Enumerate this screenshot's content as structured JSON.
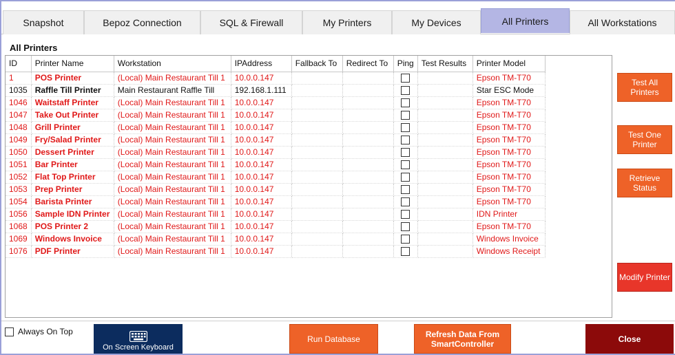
{
  "tabs": [
    {
      "label": "Snapshot"
    },
    {
      "label": "Bepoz Connection"
    },
    {
      "label": "SQL & Firewall"
    },
    {
      "label": "My Printers"
    },
    {
      "label": "My Devices"
    },
    {
      "label": "All Printers",
      "active": true
    },
    {
      "label": "All Workstations"
    }
  ],
  "panel_title": "All Printers",
  "columns": [
    "ID",
    "Printer Name",
    "Workstation",
    "IPAddress",
    "Fallback To",
    "Redirect To",
    "Ping",
    "Test Results",
    "Printer Model"
  ],
  "rows": [
    {
      "id": "1",
      "name": "POS Printer",
      "workstation": "(Local) Main Restaurant Till 1",
      "ip": "10.0.0.147",
      "fallback": "",
      "redirect": "",
      "ping": false,
      "test_results": "",
      "model": "Epson TM-T70",
      "status": "error"
    },
    {
      "id": "1035",
      "name": "Raffle Till Printer",
      "workstation": "Main Restaurant Raffle Till",
      "ip": "192.168.1.111",
      "fallback": "",
      "redirect": "",
      "ping": false,
      "test_results": "",
      "model": "Star ESC Mode",
      "status": "ok"
    },
    {
      "id": "1046",
      "name": "Waitstaff Printer",
      "workstation": "(Local) Main Restaurant Till 1",
      "ip": "10.0.0.147",
      "fallback": "",
      "redirect": "",
      "ping": false,
      "test_results": "",
      "model": "Epson TM-T70",
      "status": "error"
    },
    {
      "id": "1047",
      "name": "Take Out Printer",
      "workstation": "(Local) Main Restaurant Till 1",
      "ip": "10.0.0.147",
      "fallback": "",
      "redirect": "",
      "ping": false,
      "test_results": "",
      "model": "Epson TM-T70",
      "status": "error"
    },
    {
      "id": "1048",
      "name": "Grill Printer",
      "workstation": "(Local) Main Restaurant Till 1",
      "ip": "10.0.0.147",
      "fallback": "",
      "redirect": "",
      "ping": false,
      "test_results": "",
      "model": "Epson TM-T70",
      "status": "error"
    },
    {
      "id": "1049",
      "name": "Fry/Salad Printer",
      "workstation": "(Local) Main Restaurant Till 1",
      "ip": "10.0.0.147",
      "fallback": "",
      "redirect": "",
      "ping": false,
      "test_results": "",
      "model": "Epson TM-T70",
      "status": "error"
    },
    {
      "id": "1050",
      "name": "Dessert Printer",
      "workstation": "(Local) Main Restaurant Till 1",
      "ip": "10.0.0.147",
      "fallback": "",
      "redirect": "",
      "ping": false,
      "test_results": "",
      "model": "Epson TM-T70",
      "status": "error"
    },
    {
      "id": "1051",
      "name": "Bar Printer",
      "workstation": "(Local) Main Restaurant Till 1",
      "ip": "10.0.0.147",
      "fallback": "",
      "redirect": "",
      "ping": false,
      "test_results": "",
      "model": "Epson TM-T70",
      "status": "error"
    },
    {
      "id": "1052",
      "name": "Flat Top Printer",
      "workstation": "(Local) Main Restaurant Till 1",
      "ip": "10.0.0.147",
      "fallback": "",
      "redirect": "",
      "ping": false,
      "test_results": "",
      "model": "Epson TM-T70",
      "status": "error"
    },
    {
      "id": "1053",
      "name": "Prep Printer",
      "workstation": "(Local) Main Restaurant Till 1",
      "ip": "10.0.0.147",
      "fallback": "",
      "redirect": "",
      "ping": false,
      "test_results": "",
      "model": "Epson TM-T70",
      "status": "error"
    },
    {
      "id": "1054",
      "name": "Barista Printer",
      "workstation": "(Local) Main Restaurant Till 1",
      "ip": "10.0.0.147",
      "fallback": "",
      "redirect": "",
      "ping": false,
      "test_results": "",
      "model": "Epson TM-T70",
      "status": "error"
    },
    {
      "id": "1056",
      "name": "Sample IDN Printer",
      "workstation": "(Local) Main Restaurant Till 1",
      "ip": "10.0.0.147",
      "fallback": "",
      "redirect": "",
      "ping": false,
      "test_results": "",
      "model": "IDN Printer",
      "status": "error"
    },
    {
      "id": "1068",
      "name": "POS Printer 2",
      "workstation": "(Local) Main Restaurant Till 1",
      "ip": "10.0.0.147",
      "fallback": "",
      "redirect": "",
      "ping": false,
      "test_results": "",
      "model": "Epson TM-T70",
      "status": "error"
    },
    {
      "id": "1069",
      "name": "Windows Invoice",
      "workstation": "(Local) Main Restaurant Till 1",
      "ip": "10.0.0.147",
      "fallback": "",
      "redirect": "",
      "ping": false,
      "test_results": "",
      "model": "Windows Invoice",
      "status": "error"
    },
    {
      "id": "1076",
      "name": "PDF Printer",
      "workstation": "(Local) Main Restaurant Till 1",
      "ip": "10.0.0.147",
      "fallback": "",
      "redirect": "",
      "ping": false,
      "test_results": "",
      "model": "Windows Receipt",
      "status": "error"
    }
  ],
  "side_buttons": {
    "test_all": "Test All Printers",
    "test_one": "Test One Printer",
    "retrieve_status": "Retrieve Status",
    "modify": "Modify Printer"
  },
  "bottom": {
    "always_on_top": "Always On Top",
    "always_on_top_checked": false,
    "keyboard": "On Screen Keyboard",
    "run_database": "Run Database",
    "refresh": "Refresh Data From SmartController",
    "close": "Close"
  },
  "colors": {
    "accent": "#ee6228",
    "active_tab": "#b4b6e4",
    "error_text": "#e01818",
    "close": "#8c0a0a",
    "keyboard": "#0c2c5e"
  }
}
